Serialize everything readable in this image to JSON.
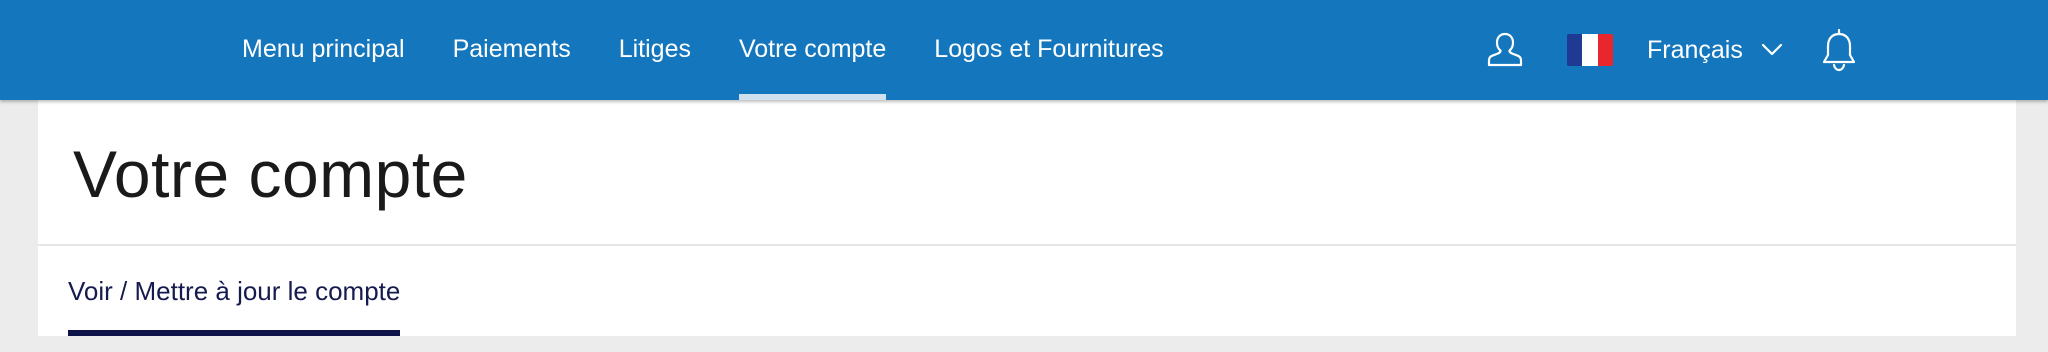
{
  "nav": {
    "links": [
      {
        "label": "Menu principal",
        "active": false
      },
      {
        "label": "Paiements",
        "active": false
      },
      {
        "label": "Litiges",
        "active": false
      },
      {
        "label": "Votre compte",
        "active": true
      },
      {
        "label": "Logos et Fournitures",
        "active": false
      }
    ],
    "language": "Français",
    "icons": [
      "user-icon",
      "france-flag-icon",
      "chevron-down-icon",
      "bell-icon"
    ],
    "colors": {
      "bar": "#1477bd",
      "active_underline": "#cfe0ef",
      "text": "#ffffff"
    }
  },
  "page": {
    "title": "Votre compte",
    "subtab": "Voir / Mettre à jour le compte",
    "colors": {
      "subtab_text": "#161b4f",
      "subtab_underline": "#0e1449",
      "background": "#ececec",
      "panel": "#ffffff"
    }
  }
}
